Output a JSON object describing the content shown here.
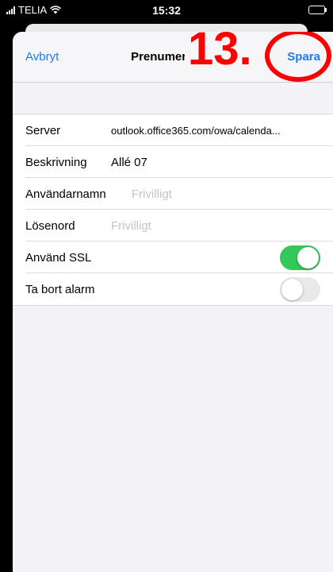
{
  "status_bar": {
    "carrier": "TELIA",
    "time": "15:32"
  },
  "nav": {
    "cancel_label": "Avbryt",
    "title": "Prenumeration",
    "save_label": "Spara"
  },
  "annotation": {
    "step_label": "13."
  },
  "form": {
    "server_label": "Server",
    "server_value": "outlook.office365.com/owa/calenda...",
    "description_label": "Beskrivning",
    "description_value": "Allé 07",
    "username_label": "Användarnamn",
    "username_placeholder": "Frivilligt",
    "password_label": "Lösenord",
    "password_placeholder": "Frivilligt",
    "ssl_label": "Använd SSL",
    "ssl_enabled": true,
    "remove_alarm_label": "Ta bort alarm",
    "remove_alarm_enabled": false
  },
  "colors": {
    "accent": "#1a7cf5",
    "toggle_on": "#34c759",
    "annotation": "#ff0000"
  }
}
